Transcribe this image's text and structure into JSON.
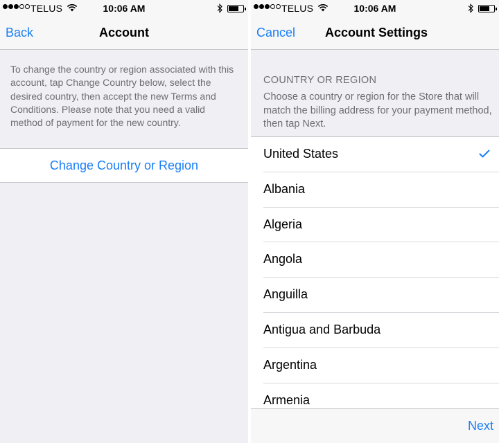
{
  "status_bar": {
    "carrier": "TELUS",
    "time": "10:06 AM",
    "signal_bars_filled": 3,
    "signal_bars_total": 5
  },
  "left_screen": {
    "nav": {
      "back_label": "Back",
      "title": "Account"
    },
    "info_text": "To change the country or region associated with this account, tap Change Country below, select the desired country, then accept the new Terms and Conditions. Please note that you need a valid method of payment for the new country.",
    "change_button_label": "Change Country or Region"
  },
  "right_screen": {
    "nav": {
      "cancel_label": "Cancel",
      "title": "Account Settings"
    },
    "section_header": "COUNTRY OR REGION",
    "section_description": "Choose a country or region for the Store that will match the billing address for your payment method, then tap Next.",
    "countries": [
      {
        "name": "United States",
        "selected": true
      },
      {
        "name": "Albania",
        "selected": false
      },
      {
        "name": "Algeria",
        "selected": false
      },
      {
        "name": "Angola",
        "selected": false
      },
      {
        "name": "Anguilla",
        "selected": false
      },
      {
        "name": "Antigua and Barbuda",
        "selected": false
      },
      {
        "name": "Argentina",
        "selected": false
      },
      {
        "name": "Armenia",
        "selected": false
      }
    ],
    "next_label": "Next"
  },
  "colors": {
    "accent": "#1a7ef7",
    "background": "#efeff4",
    "secondary_text": "#6d6d72"
  }
}
